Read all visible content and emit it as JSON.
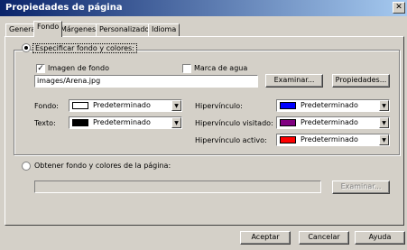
{
  "window": {
    "title": "Propiedades de página",
    "close_glyph": "✕"
  },
  "tabs": [
    {
      "label": "General",
      "active": false
    },
    {
      "label": "Fondo",
      "active": true
    },
    {
      "label": "Márgenes",
      "active": false
    },
    {
      "label": "Personalizado",
      "active": false
    },
    {
      "label": "Idioma",
      "active": false
    }
  ],
  "specify": {
    "radio_label": "Especificar fondo y colores:",
    "selected": true,
    "background_image": {
      "checkbox_label": "Imagen de fondo",
      "checked": true,
      "value": "images/Arena.jpg"
    },
    "watermark": {
      "checkbox_label": "Marca de agua",
      "checked": false
    },
    "browse_button": "Examinar...",
    "properties_button": "Propiedades...",
    "colors": {
      "fondo": {
        "label": "Fondo:",
        "value": "Predeterminado",
        "color": "#ffffff"
      },
      "texto": {
        "label": "Texto:",
        "value": "Predeterminado",
        "color": "#000000"
      },
      "hipervinculo": {
        "label": "Hipervínculo:",
        "value": "Predeterminado",
        "color": "#0000ff"
      },
      "visitado": {
        "label": "Hipervínculo visitado:",
        "value": "Predeterminado",
        "color": "#800080"
      },
      "activo": {
        "label": "Hipervínculo activo:",
        "value": "Predeterminado",
        "color": "#ff0000"
      }
    }
  },
  "from_page": {
    "radio_label": "Obtener fondo y colores de la página:",
    "selected": false,
    "value": "",
    "browse_button": "Examinar..."
  },
  "footer": {
    "accept": "Aceptar",
    "cancel": "Cancelar",
    "help": "Ayuda"
  },
  "icons": {
    "check_glyph": "✓",
    "dropdown_glyph": "▼"
  }
}
